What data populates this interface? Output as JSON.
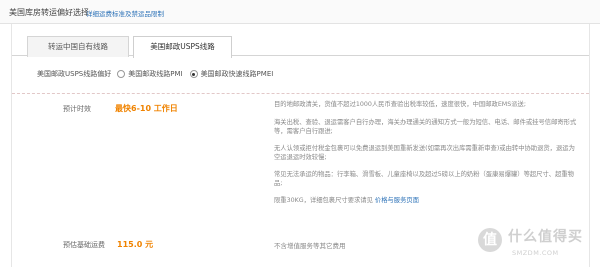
{
  "header": {
    "title": "美国库房转运偏好选择",
    "link": "详细运费标准及禁运品限制"
  },
  "tabs": [
    {
      "label": "转运中国自有线路"
    },
    {
      "label": "美国邮政USPS线路"
    }
  ],
  "preference": {
    "label": "美国邮政USPS线路偏好",
    "options": [
      {
        "label": "美国邮政线路PMI",
        "checked": false
      },
      {
        "label": "美国邮政快速线路PMEI",
        "checked": true
      }
    ]
  },
  "eta": {
    "label": "预计时效",
    "value": "最快6-10 工作日"
  },
  "description": {
    "p1a": "目的地邮政清关，货值不超过1000人民币查验出税率较低，速度很快，中国邮政EMS派送;",
    "p1b": "海关出税、查验、退运需客户自行办理，海关办理通关的通知方式一般为短信、电话、邮件或挂号信邮寄形式",
    "p1c": "等，需客户自行跟进;",
    "p2a": "无人认领或拒付税金包裹可以免费退运到美国重新发送(如需再次出库需重新审查)或由转中协助退货，退运为",
    "p2b": "空运退运时效较慢;",
    "p3a": "常见无法承运的物品：行李箱、滑雪板、儿童座椅以及超过5磅以上的奶粉（蛋康易爆罐）等超尺寸、超重物",
    "p3b": "品;",
    "p4": "限重30KG，详细包裹尺寸要求请见",
    "p4link": "价格与服务页面"
  },
  "fee": {
    "label": "预估基础运费",
    "value": "115.0 元",
    "note": "不含增值服务等其它费用"
  },
  "watermark": {
    "icon": "值",
    "text": "什么值得买",
    "sub": "SMZDM.COM"
  }
}
